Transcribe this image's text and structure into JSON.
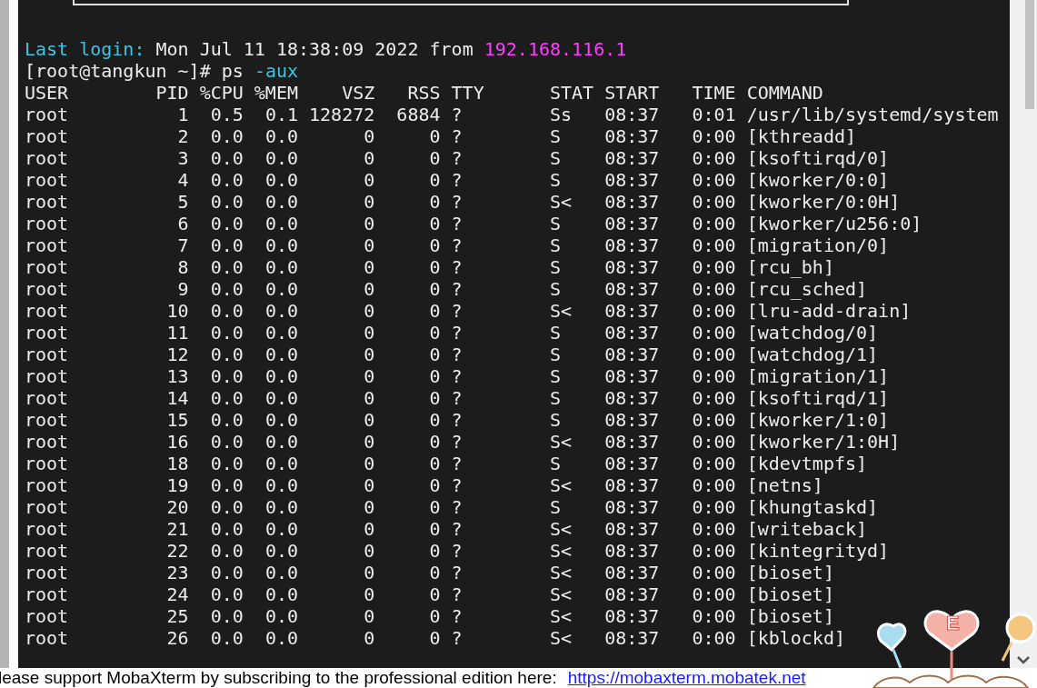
{
  "login": {
    "label": "Last login:",
    "text": "Mon Jul 11 18:38:09 2022 from",
    "host": "192.168.116.1"
  },
  "prompt": {
    "text": "[root@tangkun ~]#",
    "command": "ps",
    "option": "-aux"
  },
  "table": {
    "columns": [
      "USER",
      "PID",
      "%CPU",
      "%MEM",
      "VSZ",
      "RSS",
      "TTY",
      "STAT",
      "START",
      "TIME",
      "COMMAND"
    ],
    "rows": [
      [
        "root",
        "1",
        "0.5",
        "0.1",
        "128272",
        "6884",
        "?",
        "Ss",
        "08:37",
        "0:01",
        "/usr/lib/systemd/system"
      ],
      [
        "root",
        "2",
        "0.0",
        "0.0",
        "0",
        "0",
        "?",
        "S",
        "08:37",
        "0:00",
        "[kthreadd]"
      ],
      [
        "root",
        "3",
        "0.0",
        "0.0",
        "0",
        "0",
        "?",
        "S",
        "08:37",
        "0:00",
        "[ksoftirqd/0]"
      ],
      [
        "root",
        "4",
        "0.0",
        "0.0",
        "0",
        "0",
        "?",
        "S",
        "08:37",
        "0:00",
        "[kworker/0:0]"
      ],
      [
        "root",
        "5",
        "0.0",
        "0.0",
        "0",
        "0",
        "?",
        "S<",
        "08:37",
        "0:00",
        "[kworker/0:0H]"
      ],
      [
        "root",
        "6",
        "0.0",
        "0.0",
        "0",
        "0",
        "?",
        "S",
        "08:37",
        "0:00",
        "[kworker/u256:0]"
      ],
      [
        "root",
        "7",
        "0.0",
        "0.0",
        "0",
        "0",
        "?",
        "S",
        "08:37",
        "0:00",
        "[migration/0]"
      ],
      [
        "root",
        "8",
        "0.0",
        "0.0",
        "0",
        "0",
        "?",
        "S",
        "08:37",
        "0:00",
        "[rcu_bh]"
      ],
      [
        "root",
        "9",
        "0.0",
        "0.0",
        "0",
        "0",
        "?",
        "S",
        "08:37",
        "0:00",
        "[rcu_sched]"
      ],
      [
        "root",
        "10",
        "0.0",
        "0.0",
        "0",
        "0",
        "?",
        "S<",
        "08:37",
        "0:00",
        "[lru-add-drain]"
      ],
      [
        "root",
        "11",
        "0.0",
        "0.0",
        "0",
        "0",
        "?",
        "S",
        "08:37",
        "0:00",
        "[watchdog/0]"
      ],
      [
        "root",
        "12",
        "0.0",
        "0.0",
        "0",
        "0",
        "?",
        "S",
        "08:37",
        "0:00",
        "[watchdog/1]"
      ],
      [
        "root",
        "13",
        "0.0",
        "0.0",
        "0",
        "0",
        "?",
        "S",
        "08:37",
        "0:00",
        "[migration/1]"
      ],
      [
        "root",
        "14",
        "0.0",
        "0.0",
        "0",
        "0",
        "?",
        "S",
        "08:37",
        "0:00",
        "[ksoftirqd/1]"
      ],
      [
        "root",
        "15",
        "0.0",
        "0.0",
        "0",
        "0",
        "?",
        "S",
        "08:37",
        "0:00",
        "[kworker/1:0]"
      ],
      [
        "root",
        "16",
        "0.0",
        "0.0",
        "0",
        "0",
        "?",
        "S<",
        "08:37",
        "0:00",
        "[kworker/1:0H]"
      ],
      [
        "root",
        "18",
        "0.0",
        "0.0",
        "0",
        "0",
        "?",
        "S",
        "08:37",
        "0:00",
        "[kdevtmpfs]"
      ],
      [
        "root",
        "19",
        "0.0",
        "0.0",
        "0",
        "0",
        "?",
        "S<",
        "08:37",
        "0:00",
        "[netns]"
      ],
      [
        "root",
        "20",
        "0.0",
        "0.0",
        "0",
        "0",
        "?",
        "S",
        "08:37",
        "0:00",
        "[khungtaskd]"
      ],
      [
        "root",
        "21",
        "0.0",
        "0.0",
        "0",
        "0",
        "?",
        "S<",
        "08:37",
        "0:00",
        "[writeback]"
      ],
      [
        "root",
        "22",
        "0.0",
        "0.0",
        "0",
        "0",
        "?",
        "S<",
        "08:37",
        "0:00",
        "[kintegrityd]"
      ],
      [
        "root",
        "23",
        "0.0",
        "0.0",
        "0",
        "0",
        "?",
        "S<",
        "08:37",
        "0:00",
        "[bioset]"
      ],
      [
        "root",
        "24",
        "0.0",
        "0.0",
        "0",
        "0",
        "?",
        "S<",
        "08:37",
        "0:00",
        "[bioset]"
      ],
      [
        "root",
        "25",
        "0.0",
        "0.0",
        "0",
        "0",
        "?",
        "S<",
        "08:37",
        "0:00",
        "[bioset]"
      ],
      [
        "root",
        "26",
        "0.0",
        "0.0",
        "0",
        "0",
        "?",
        "S<",
        "08:37",
        "0:00",
        "[kblockd]"
      ]
    ]
  },
  "notice": {
    "text": "lease support MobaXterm by subscribing to the professional edition here:",
    "link": "https://mobaxterm.mobatek.net"
  },
  "mascot": {
    "badge": "E"
  }
}
